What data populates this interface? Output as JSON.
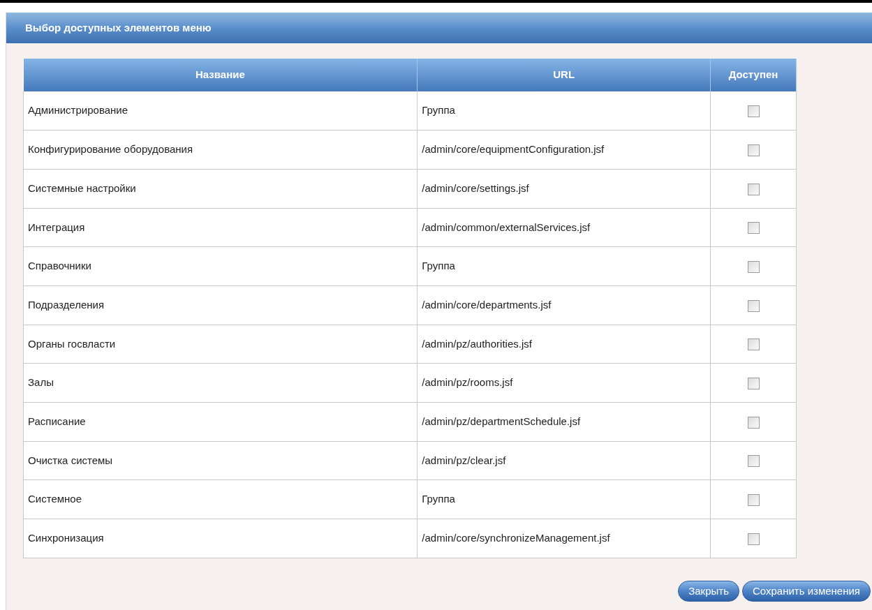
{
  "panel": {
    "title": "Выбор доступных элементов меню"
  },
  "table": {
    "columns": [
      "Название",
      "URL",
      "Доступен"
    ],
    "rows": [
      {
        "name": "Администрирование",
        "url": "Группа",
        "available": false
      },
      {
        "name": "Конфигурирование оборудования",
        "url": "/admin/core/equipmentConfiguration.jsf",
        "available": false
      },
      {
        "name": "Системные настройки",
        "url": "/admin/core/settings.jsf",
        "available": false
      },
      {
        "name": "Интеграция",
        "url": "/admin/common/externalServices.jsf",
        "available": false
      },
      {
        "name": "Справочники",
        "url": "Группа",
        "available": false
      },
      {
        "name": "Подразделения",
        "url": "/admin/core/departments.jsf",
        "available": false
      },
      {
        "name": "Органы госвласти",
        "url": "/admin/pz/authorities.jsf",
        "available": false
      },
      {
        "name": "Залы",
        "url": "/admin/pz/rooms.jsf",
        "available": false
      },
      {
        "name": "Расписание",
        "url": "/admin/pz/departmentSchedule.jsf",
        "available": false
      },
      {
        "name": "Очистка системы",
        "url": "/admin/pz/clear.jsf",
        "available": false
      },
      {
        "name": "Системное",
        "url": "Группа",
        "available": false
      },
      {
        "name": "Синхронизация",
        "url": "/admin/core/synchronizeManagement.jsf",
        "available": false
      }
    ]
  },
  "buttons": [
    {
      "label": "Закрыть"
    },
    {
      "label": "Сохранить изменения"
    }
  ]
}
